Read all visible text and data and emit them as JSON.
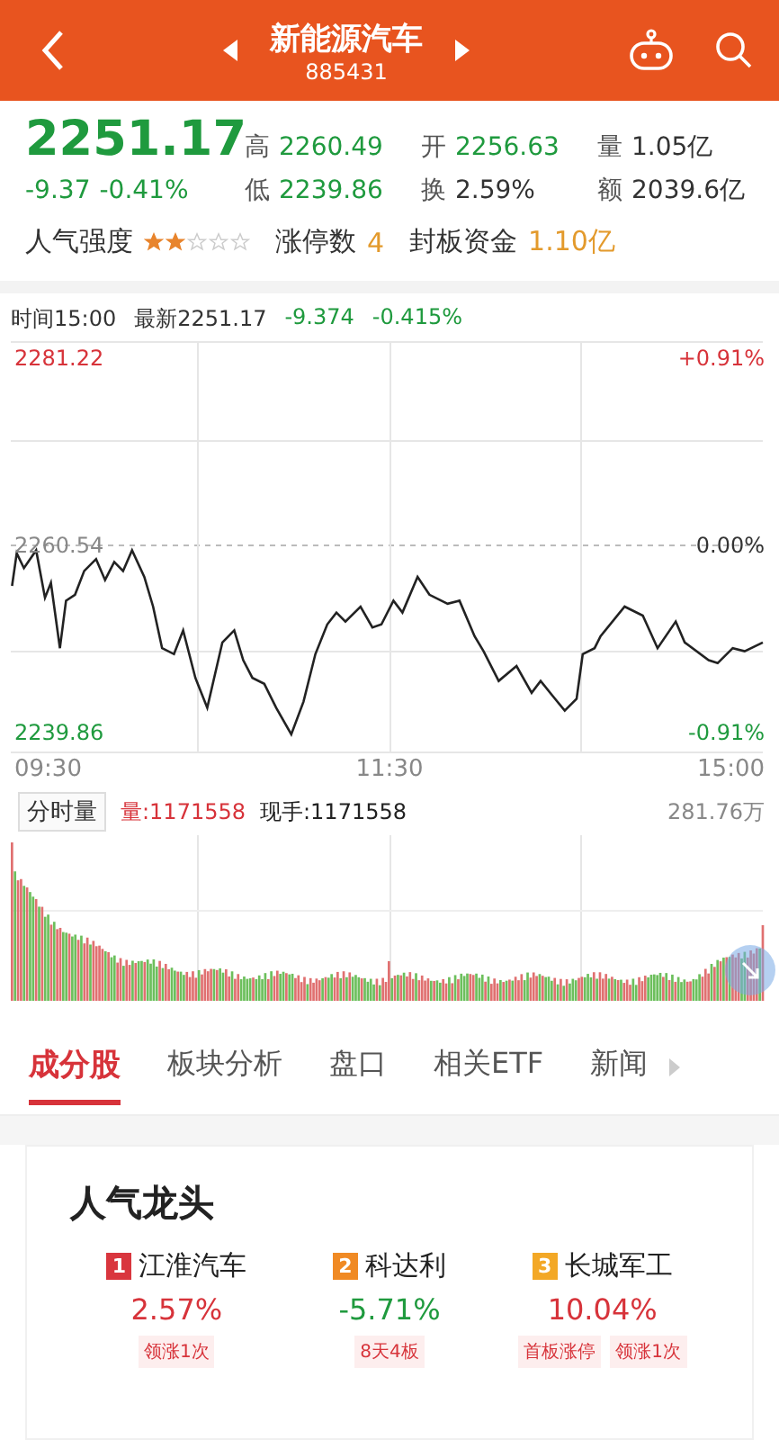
{
  "header": {
    "title": "新能源汽车",
    "code": "885431"
  },
  "quote": {
    "price": "2251.17",
    "change": "-9.37",
    "change_pct": "-0.41%",
    "color": "#1f9a3e",
    "stats": [
      {
        "label": "高",
        "value": "2260.49",
        "color": "#1f9a3e"
      },
      {
        "label": "开",
        "value": "2256.63",
        "color": "#1f9a3e"
      },
      {
        "label": "量",
        "value": "1.05亿",
        "color": "#333333"
      },
      {
        "label": "低",
        "value": "2239.86",
        "color": "#1f9a3e"
      },
      {
        "label": "换",
        "value": "2.59%",
        "color": "#333333"
      },
      {
        "label": "额",
        "value": "2039.6亿",
        "color": "#333333"
      }
    ]
  },
  "popularity": {
    "label": "人气强度",
    "stars": 2,
    "limit_up_label": "涨停数",
    "limit_up_count": "4",
    "seal_label": "封板资金",
    "seal_value": "1.10亿"
  },
  "info_line": {
    "time": "时间15:00",
    "latest": "最新2251.17",
    "change": "-9.374",
    "change_pct": "-0.415%",
    "color": "#1f9a3e"
  },
  "price_chart": {
    "right_labels": [
      {
        "text": "+0.91%",
        "color": "#d7333a"
      },
      {
        "text": "0.00%",
        "color": "#333333"
      },
      {
        "text": "-0.91%",
        "color": "#1f9a3e"
      }
    ],
    "time_labels": [
      "09:30",
      "11:30",
      "15:00"
    ],
    "price_labels": [
      "2281.22",
      "2260.54",
      "2239.86"
    ]
  },
  "volume": {
    "label": "分时量",
    "volume": "量:1171558",
    "hand": "现手:1171558",
    "max": "281.76万"
  },
  "tabs": [
    {
      "label": "成分股",
      "selected": true
    },
    {
      "label": "板块分析",
      "selected": false
    },
    {
      "label": "盘口",
      "selected": false
    },
    {
      "label": "相关ETF",
      "selected": false
    },
    {
      "label": "新闻",
      "selected": false
    }
  ],
  "leaders": {
    "title": "人气龙头",
    "items": [
      {
        "rank": "1",
        "color": "#d9363e",
        "name": "江淮汽车",
        "change": {
          "text": "2.57%",
          "color": "#d7333a"
        },
        "tags": [
          "领涨1次"
        ]
      },
      {
        "rank": "2",
        "color": "#f08a24",
        "name": "科达利",
        "change": {
          "text": "-5.71%",
          "color": "#1f9a3e"
        },
        "tags": [
          "8天4板"
        ]
      },
      {
        "rank": "3",
        "color": "#f3a826",
        "name": "长城军工",
        "change": {
          "text": "10.04%",
          "color": "#d7333a"
        },
        "tags": [
          "首板涨停",
          "领涨1次"
        ]
      }
    ]
  }
}
